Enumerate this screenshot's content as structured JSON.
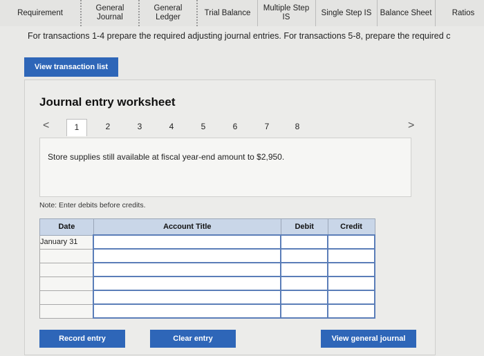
{
  "tabs": [
    {
      "label": "Requirement"
    },
    {
      "label_line1": "General",
      "label_line2": "Journal"
    },
    {
      "label_line1": "General",
      "label_line2": "Ledger"
    },
    {
      "label": "Trial Balance"
    },
    {
      "label_line1": "Multiple Step",
      "label_line2": "IS"
    },
    {
      "label": "Single Step IS"
    },
    {
      "label": "Balance Sheet"
    },
    {
      "label": "Ratios"
    }
  ],
  "instructions": "For transactions 1-4 prepare the required adjusting journal entries. For transactions 5-8, prepare the required c",
  "view_button": "View transaction list",
  "worksheet": {
    "title": "Journal entry worksheet",
    "pages": [
      "1",
      "2",
      "3",
      "4",
      "5",
      "6",
      "7",
      "8"
    ],
    "active_page": "1",
    "prev": "<",
    "next": ">",
    "description": "Store supplies still available at fiscal year-end amount to $2,950.",
    "note": "Note: Enter debits before credits."
  },
  "table": {
    "headers": {
      "date": "Date",
      "account": "Account Title",
      "debit": "Debit",
      "credit": "Credit"
    },
    "first_date": "January 31"
  },
  "buttons": {
    "record": "Record entry",
    "clear": "Clear entry",
    "view_journal": "View general journal"
  }
}
